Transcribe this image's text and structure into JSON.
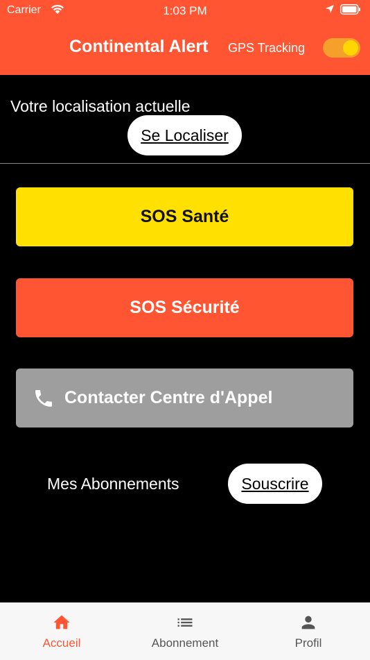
{
  "status_bar": {
    "carrier": "Carrier",
    "time": "1:03 PM"
  },
  "header": {
    "title": "Continental Alert",
    "gps_label": "GPS Tracking",
    "gps_enabled": true
  },
  "location": {
    "label": "Votre localisation actuelle",
    "button_label": "Se Localiser"
  },
  "actions": {
    "sos_sante": "SOS Santé",
    "sos_securite": "SOS Sécurité",
    "call_center": "Contacter Centre d'Appel"
  },
  "subscriptions": {
    "label": "Mes Abonnements",
    "button_label": "Souscrire"
  },
  "tabs": [
    {
      "label": "Accueil",
      "icon": "home-icon",
      "active": true
    },
    {
      "label": "Abonnement",
      "icon": "list-icon",
      "active": false
    },
    {
      "label": "Profil",
      "icon": "person-icon",
      "active": false
    }
  ],
  "colors": {
    "accent": "#ff5533",
    "sos_sante": "#ffe000",
    "call_center": "#9e9e9e"
  }
}
